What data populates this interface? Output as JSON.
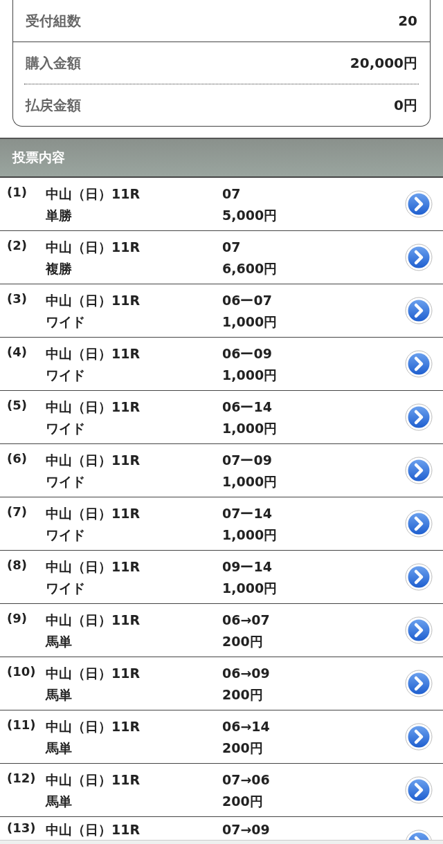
{
  "summary": [
    {
      "label": "受付組数",
      "value": "20",
      "kind": "solid"
    },
    {
      "label": "購入金額",
      "value": "20,000円",
      "kind": "dotted"
    },
    {
      "label": "払戻金額",
      "value": "0円",
      "kind": "plain"
    }
  ],
  "section_title": "投票内容",
  "bets": [
    {
      "number": "(1)",
      "race": "中山（日）11R",
      "type": "単勝",
      "combination": "07",
      "amount": "5,000円"
    },
    {
      "number": "(2)",
      "race": "中山（日）11R",
      "type": "複勝",
      "combination": "07",
      "amount": "6,600円"
    },
    {
      "number": "(3)",
      "race": "中山（日）11R",
      "type": "ワイド",
      "combination": "06ー07",
      "amount": "1,000円"
    },
    {
      "number": "(4)",
      "race": "中山（日）11R",
      "type": "ワイド",
      "combination": "06ー09",
      "amount": "1,000円"
    },
    {
      "number": "(5)",
      "race": "中山（日）11R",
      "type": "ワイド",
      "combination": "06ー14",
      "amount": "1,000円"
    },
    {
      "number": "(6)",
      "race": "中山（日）11R",
      "type": "ワイド",
      "combination": "07ー09",
      "amount": "1,000円"
    },
    {
      "number": "(7)",
      "race": "中山（日）11R",
      "type": "ワイド",
      "combination": "07ー14",
      "amount": "1,000円"
    },
    {
      "number": "(8)",
      "race": "中山（日）11R",
      "type": "ワイド",
      "combination": "09ー14",
      "amount": "1,000円"
    },
    {
      "number": "(9)",
      "race": "中山（日）11R",
      "type": "馬単",
      "combination": "06→07",
      "amount": "200円"
    },
    {
      "number": "(10)",
      "race": "中山（日）11R",
      "type": "馬単",
      "combination": "06→09",
      "amount": "200円"
    },
    {
      "number": "(11)",
      "race": "中山（日）11R",
      "type": "馬単",
      "combination": "06→14",
      "amount": "200円"
    },
    {
      "number": "(12)",
      "race": "中山（日）11R",
      "type": "馬単",
      "combination": "07→06",
      "amount": "200円"
    },
    {
      "number": "(13)",
      "race": "中山（日）11R",
      "combination": "07→09"
    }
  ]
}
